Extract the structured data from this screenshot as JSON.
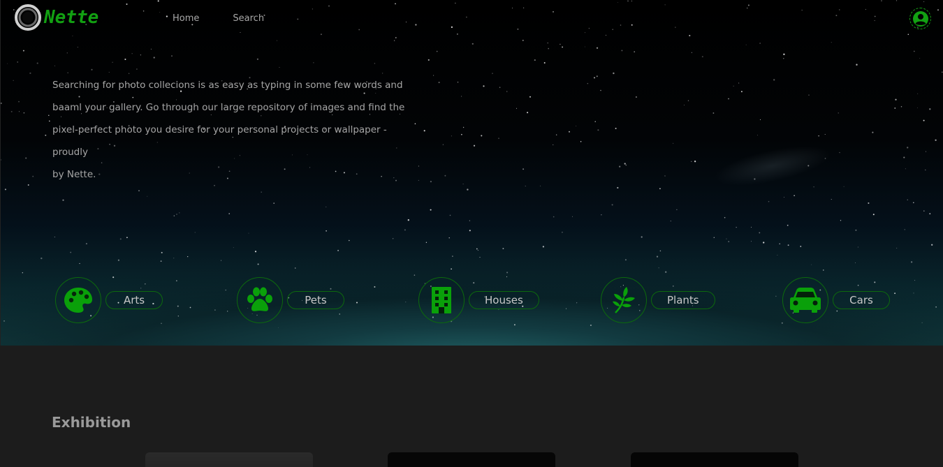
{
  "brand": {
    "name": "Nette",
    "accent": "#12a012"
  },
  "nav": {
    "home": "Home",
    "search": "Search"
  },
  "user": {
    "icon": "user-circle-icon"
  },
  "intro": {
    "lines": [
      "Searching for photo collecions is as easy as typing in some few words and",
      "baaml your gallery. Go through our large repository of images and find the",
      "pixel-perfect photo you desire for your personal projects or wallpaper - proudly",
      "by Nette."
    ]
  },
  "categories": [
    {
      "label": "Arts",
      "icon": "palette-icon"
    },
    {
      "label": "Pets",
      "icon": "paw-icon"
    },
    {
      "label": "Houses",
      "icon": "building-icon"
    },
    {
      "label": "Plants",
      "icon": "leaf-icon"
    },
    {
      "label": "Cars",
      "icon": "car-icon"
    }
  ],
  "exhibition": {
    "title": "Exhibition"
  }
}
